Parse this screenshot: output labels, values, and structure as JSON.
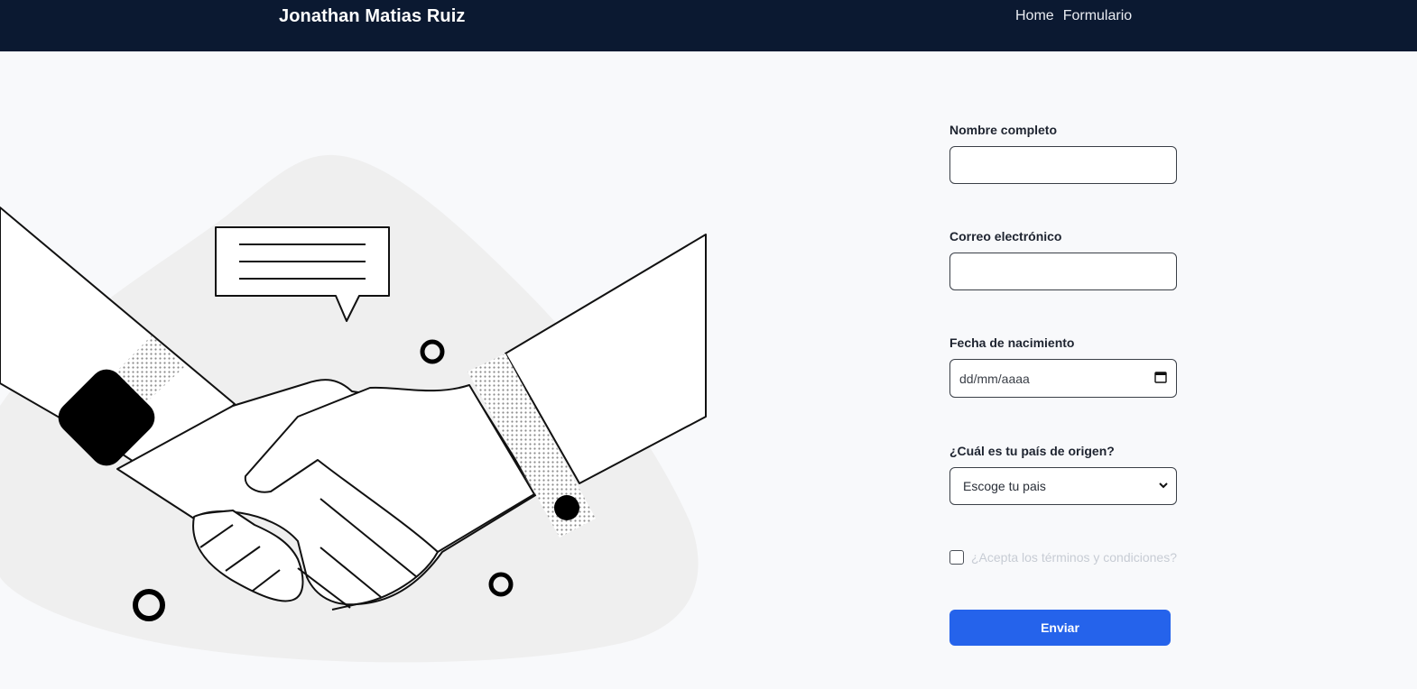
{
  "header": {
    "brand": "Jonathan Matias Ruiz",
    "nav": [
      {
        "label": "Home"
      },
      {
        "label": "Formulario"
      }
    ]
  },
  "form": {
    "name": {
      "label": "Nombre completo",
      "value": ""
    },
    "email": {
      "label": "Correo electrónico",
      "value": ""
    },
    "birthdate": {
      "label": "Fecha de nacimiento",
      "placeholder": "dd/mm/aaaa"
    },
    "country": {
      "label": "¿Cuál es tu país de origen?",
      "selected": "Escoge tu pais"
    },
    "terms": {
      "label": "¿Acepta los términos y condiciones?",
      "checked": false
    },
    "submit_label": "Enviar"
  },
  "icons": {
    "calendar": "calendar-icon",
    "chevron": "chevron-down-icon"
  },
  "colors": {
    "header_bg": "#0b1931",
    "accent": "#2563eb",
    "page_bg": "#f8f9fb"
  }
}
